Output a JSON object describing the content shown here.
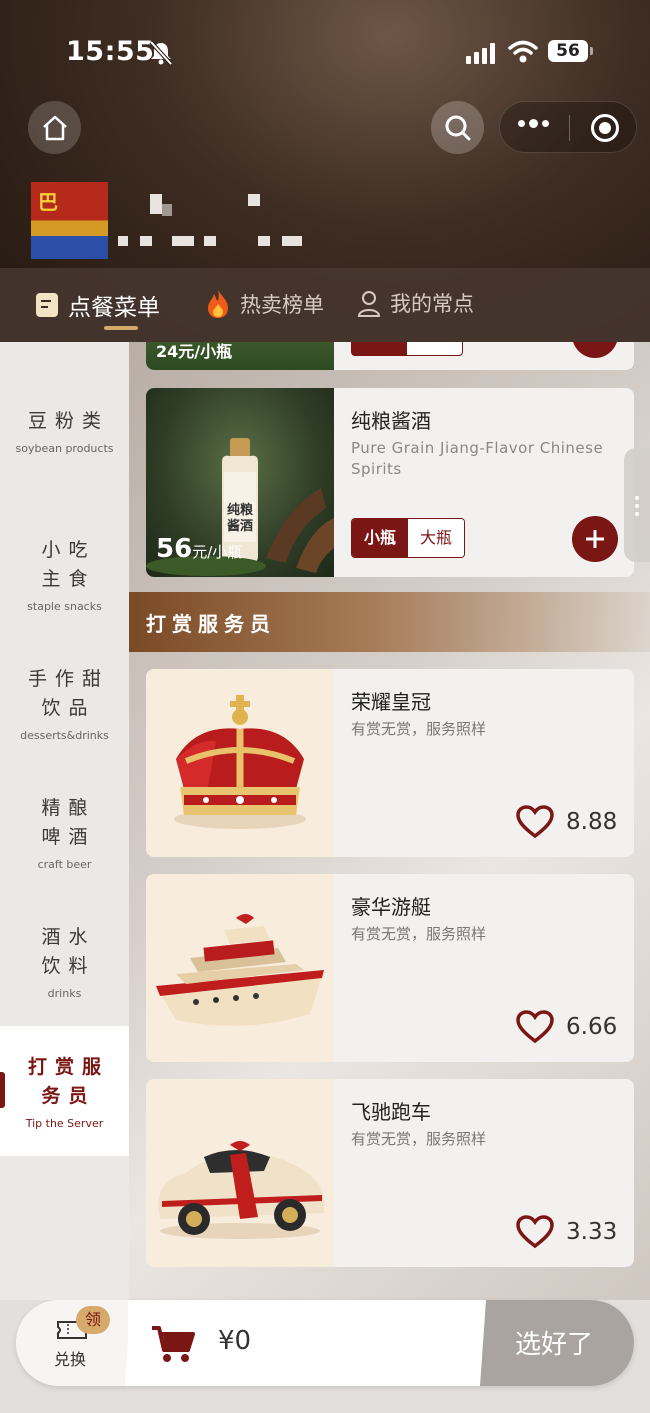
{
  "status_bar": {
    "time": "15:55",
    "battery": "56"
  },
  "tabs": [
    {
      "label": "点餐菜单",
      "icon": "menu-book-icon",
      "active": true
    },
    {
      "label": "热卖榜单",
      "icon": "fire-icon",
      "active": false
    },
    {
      "label": "我的常点",
      "icon": "user-icon",
      "active": false
    }
  ],
  "store": {
    "logo_text": "巴"
  },
  "sidebar": {
    "items": [
      {
        "zh": "豆粉类",
        "en": "soybean products",
        "active": false
      },
      {
        "zh": "小吃主食",
        "en": "staple snacks",
        "active": false
      },
      {
        "zh": "手作甜饮品",
        "en": "desserts&drinks",
        "active": false
      },
      {
        "zh": "精酿啤酒",
        "en": "craft beer",
        "active": false
      },
      {
        "zh": "酒水饮料",
        "en": "drinks",
        "active": false
      },
      {
        "zh": "打赏服务员",
        "en": "Tip the Server",
        "active": true
      }
    ]
  },
  "partial_card": {
    "price_text": "24元/小瓶"
  },
  "products": [
    {
      "name": "纯粮酱酒",
      "desc": "Pure Grain Jiang-Flavor Chinese Spirits",
      "price_big": "56",
      "price_unit": "元/小瓶",
      "bottle_label": "纯粮酱酒",
      "specs": [
        "小瓶",
        "大瓶"
      ],
      "selected_spec": "小瓶"
    }
  ],
  "section": {
    "title": "打赏服务员"
  },
  "tips": [
    {
      "name": "荣耀皇冠",
      "sub": "有赏无赏，服务照样",
      "price": "8.88",
      "image": "crown"
    },
    {
      "name": "豪华游艇",
      "sub": "有赏无赏，服务照样",
      "price": "6.66",
      "image": "yacht"
    },
    {
      "name": "飞驰跑车",
      "sub": "有赏无赏，服务照样",
      "price": "3.33",
      "image": "sports-car"
    }
  ],
  "cart": {
    "exchange_label": "兑换",
    "exchange_badge": "领",
    "total": "¥0",
    "checkout_label": "选好了"
  },
  "colors": {
    "brand": "#7a1614",
    "gold": "#d5a768",
    "checkout_disabled": "#a9a4a0"
  }
}
